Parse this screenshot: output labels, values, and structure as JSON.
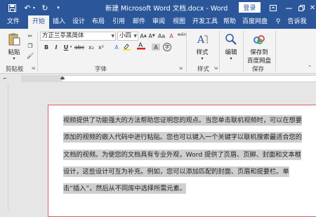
{
  "titlebar": {
    "title": "新建 Microsoft Word 文档.docx - Word",
    "login": "登录",
    "undo_icon": "undo-icon",
    "redo_icon": "redo-icon",
    "save_icon": "save-icon",
    "minimize_icon": "minimize-icon",
    "restore_icon": "restore-icon",
    "close_icon": "close-icon"
  },
  "tabs": {
    "file": "文件",
    "home": "开始",
    "insert": "插入",
    "design": "设计",
    "layout": "布局",
    "references": "引用",
    "mailings": "邮件",
    "review": "审阅",
    "view": "视图",
    "developer": "开发工具",
    "help": "帮助",
    "baidu": "百度网盘",
    "tellme": "告诉我"
  },
  "ribbon": {
    "paste": "粘贴",
    "clipboard": "剪贴板",
    "font_name": "方正兰亭黑简体",
    "font_size": "小四",
    "wen_button": "wén",
    "font_group": "字体",
    "styles": "样式",
    "styles_group": "样式",
    "editing": "编辑",
    "save_to_baidu_line1": "保存到",
    "save_to_baidu_line2": "百度网盘",
    "save_group": "保存",
    "bold": "B",
    "italic": "I",
    "underline": "U",
    "paragraph_group": "段落",
    "paragraph_partial": "落"
  },
  "document": {
    "paragraph": "视频提供了功能强大的方法帮助您证明您的观点。当您单击联机视频时，可以在想要添加的视频的嵌入代码中进行粘贴。您也可以键入一个关键字以联机搜索最适合您的文档的视频。为使您的文档具有专业外观，Word 提供了页眉、页脚、封面和文本框设计，这些设计可互为补充。例如，您可以添加匹配的封面、页眉和提要栏。单击“插入”，然后从不同库中选择所需元素。"
  },
  "colors": {
    "accent": "#2b579a",
    "selection": "#cfcfcf",
    "page_border": "#d95f5f",
    "font_color_red": "#e02020",
    "highlight_yellow": "#f2e33a"
  }
}
